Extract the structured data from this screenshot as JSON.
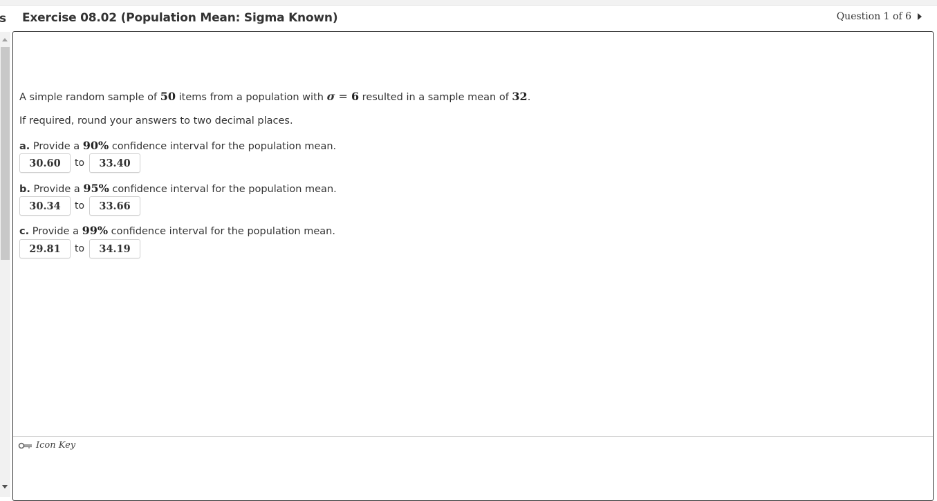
{
  "header": {
    "left_cut_text": "s",
    "title": "Exercise 08.02 (Population Mean: Sigma Known)",
    "question_nav": "Question 1 of 6"
  },
  "problem": {
    "intro": {
      "pre": "A simple random sample of ",
      "n": "50",
      "mid": " items from a population with ",
      "sigma": "σ",
      "eq": " = ",
      "sigma_value": "6",
      "post": " resulted in a sample mean of ",
      "mean": "32",
      "end": "."
    },
    "rounding_note": "If required, round your answers to two decimal places.",
    "parts": [
      {
        "letter": "a.",
        "pre": " Provide a ",
        "confidence": "90%",
        "post": " confidence interval for the population mean.",
        "lower": "30.60",
        "to": "to",
        "upper": "33.40"
      },
      {
        "letter": "b.",
        "pre": " Provide a ",
        "confidence": "95%",
        "post": " confidence interval for the population mean.",
        "lower": "30.34",
        "to": "to",
        "upper": "33.66"
      },
      {
        "letter": "c.",
        "pre": " Provide a ",
        "confidence": "99%",
        "post": " confidence interval for the population mean.",
        "lower": "29.81",
        "to": "to",
        "upper": "34.19"
      }
    ]
  },
  "footer": {
    "icon_key_label": "Icon Key",
    "icon": "key-icon"
  }
}
